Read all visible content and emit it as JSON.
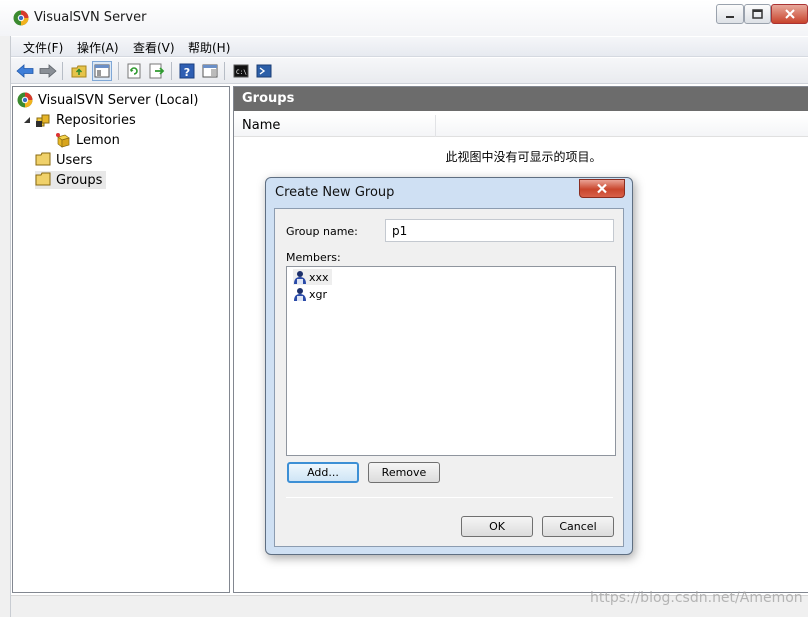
{
  "window": {
    "title": "VisualSVN Server"
  },
  "menu": [
    {
      "label": "文件(F)"
    },
    {
      "label": "操作(A)"
    },
    {
      "label": "查看(V)"
    },
    {
      "label": "帮助(H)"
    }
  ],
  "toolbar": {
    "icons": [
      "back-arrow-icon",
      "forward-arrow-icon",
      "up-folder-icon",
      "show-hide-tree-icon",
      "refresh-icon",
      "export-list-icon",
      "help-icon",
      "action-pane-icon",
      "console-icon",
      "powershell-icon"
    ]
  },
  "tree": {
    "root": "VisualSVN Server (Local)",
    "repositories": "Repositories",
    "repo_item": "Lemon",
    "users": "Users",
    "groups": "Groups"
  },
  "right_pane": {
    "header": "Groups",
    "column_name": "Name",
    "empty_message": "此视图中没有可显示的项目。"
  },
  "dialog": {
    "title": "Create New Group",
    "group_name_label": "Group name:",
    "group_name_value": "p1",
    "members_label": "Members:",
    "members": [
      "xxx",
      "xgr"
    ],
    "add_label": "Add...",
    "remove_label": "Remove",
    "ok_label": "OK",
    "cancel_label": "Cancel"
  },
  "watermark": "https://blog.csdn.net/Amemon",
  "colors": {
    "groups_header_bg": "#6c6c6c",
    "dialog_frame": "#cfe0f3",
    "close_button": "#c9462d"
  }
}
